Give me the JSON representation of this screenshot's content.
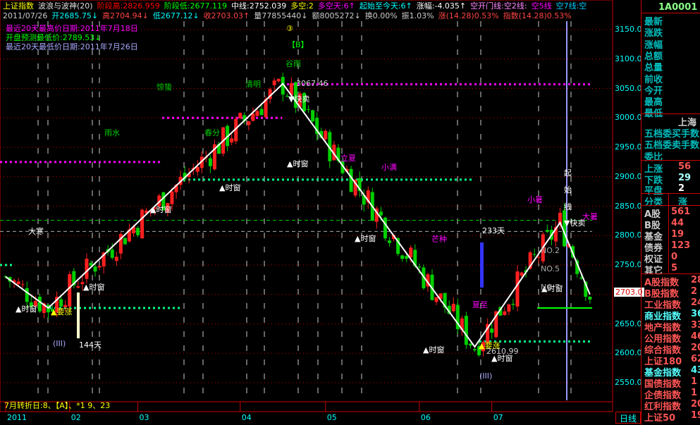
{
  "header": {
    "row1": [
      {
        "t": "上证指数",
        "c": "#ff0"
      },
      {
        "t": "波浪与波神(20)",
        "c": "#ddd"
      },
      {
        "t": "阶段高:2826.959",
        "c": "#f00"
      },
      {
        "t": "阶段低:2677.119",
        "c": "#0f0"
      },
      {
        "t": "中线:2752.039",
        "c": "#fff"
      },
      {
        "t": "多空:2",
        "c": "#ff0"
      },
      {
        "t": "多空天:6↑",
        "c": "#f0f"
      },
      {
        "t": "起始至今天:6↑",
        "c": "#0ff"
      },
      {
        "t": "涨幅:-4.035↑",
        "c": "#fff"
      },
      {
        "t": "空开门线:空2线:",
        "c": "#f8f"
      },
      {
        "t": "空5线",
        "c": "#f0f"
      },
      {
        "t": "空7线:空",
        "c": "#0cf"
      }
    ],
    "row2": [
      {
        "t": "2011/07/26",
        "c": "#ccc"
      },
      {
        "t": "开2685.75↓",
        "c": "#0ff"
      },
      {
        "t": "高2704.94↓",
        "c": "#f44"
      },
      {
        "t": "低2677.12↓",
        "c": "#0ff"
      },
      {
        "t": "收2703.03↑",
        "c": "#f44"
      },
      {
        "t": "量77855440↓",
        "c": "#ccc"
      },
      {
        "t": "额8005272↓",
        "c": "#ccc"
      },
      {
        "t": "换0.00%",
        "c": "#ccc"
      },
      {
        "t": "振1.03%",
        "c": "#ccc"
      },
      {
        "t": "涨(14.28)0.53%",
        "c": "#f44"
      },
      {
        "t": "指数(14.28)0.53%",
        "c": "#f44"
      }
    ],
    "info": [
      {
        "t": "最近20天最高价日期:2011年7月18日",
        "c": "#f0f"
      },
      {
        "t": "开盘预测最低价:2789.53↓",
        "c": "#0f0"
      },
      {
        "t": "最近20天最低价日期:2011年7月26日",
        "c": "#aaf"
      }
    ]
  },
  "code": "1A0001",
  "axis": {
    "prices": [
      "3150.0",
      "3100.0",
      "3050.0",
      "3000.0",
      "2950.0",
      "2900.0",
      "2850.0",
      "2800.0",
      "2750.0",
      "2700.0",
      "2650.0",
      "2600.0",
      "2550.0"
    ],
    "current": "2703.0"
  },
  "months": [
    {
      "t": "2011",
      "d": 0
    },
    {
      "t": "02",
      "d": 15
    },
    {
      "t": "03",
      "d": 31
    },
    {
      "t": "04",
      "d": 55
    },
    {
      "t": "05",
      "d": 75
    },
    {
      "t": "06",
      "d": 97
    },
    {
      "t": "07",
      "d": 114
    }
  ],
  "period": "日线",
  "turning": "7月转折日:8、【A】、*1 9、23",
  "zigzag": [
    [
      0,
      2730
    ],
    [
      10,
      2677
    ],
    [
      65,
      3058
    ],
    [
      110,
      2611
    ],
    [
      130,
      2822
    ],
    [
      137,
      2700
    ]
  ],
  "annotations": {
    "terms": [
      {
        "t": "大寒",
        "c": "#fff"
      },
      {
        "t": "雨水",
        "c": "#0c0"
      },
      {
        "t": "惊蛰",
        "c": "#0c0"
      },
      {
        "t": "春分",
        "c": "#0c0"
      },
      {
        "t": "清明",
        "c": "#0c0"
      },
      {
        "t": "谷雨",
        "c": "#0c0"
      },
      {
        "t": "立夏",
        "c": "#f0f"
      },
      {
        "t": "小满",
        "c": "#f0f"
      },
      {
        "t": "芒种",
        "c": "#f0f"
      },
      {
        "t": "夏至",
        "c": "#f0f"
      },
      {
        "t": "小暑",
        "c": "#f0f"
      },
      {
        "t": "大暑",
        "c": "#f0f"
      }
    ],
    "window": "▲时窗",
    "sell": "▼快卖",
    "rise": "▲要涨",
    "high_val": "3067.46",
    "low_val": "2610.99",
    "days144": "144天",
    "days233": "233天",
    "wave": "(III)",
    "circle3": "③",
    "markB": "【B】",
    "start_line": [
      "起",
      "始",
      "线"
    ],
    "levels": [
      "NO.2",
      "NO.5",
      "NO.7"
    ]
  },
  "panel": {
    "quote_labels": [
      "最新",
      "涨跌",
      "涨幅",
      "总额",
      "总量",
      "前收",
      "今开",
      "最高",
      "最低"
    ],
    "market": "上海",
    "order_labels": [
      "五档委买手数",
      "五档委卖手数",
      "委比"
    ],
    "breadth": [
      {
        "l": "上涨",
        "v": "56"
      },
      {
        "l": "下跌",
        "v": "29"
      },
      {
        "l": "平盘",
        "v": "2"
      }
    ],
    "class_header": [
      "分类",
      "涨"
    ],
    "classes": [
      {
        "l": "A股",
        "v": "561"
      },
      {
        "l": "B股",
        "v": "44"
      },
      {
        "l": "基金",
        "v": "19"
      },
      {
        "l": "债券",
        "v": "123"
      },
      {
        "l": "权证",
        "v": "0"
      },
      {
        "l": "其它",
        "v": "5"
      }
    ],
    "indices": [
      {
        "l": "A股指数",
        "v": "28",
        "c": "#f55"
      },
      {
        "l": "B股指数",
        "v": "2",
        "c": "#f55"
      },
      {
        "l": "工业指数",
        "v": "24",
        "c": "#f55"
      },
      {
        "l": "商业指数",
        "v": "36",
        "c": "#5ff"
      },
      {
        "l": "地产指数",
        "v": "33",
        "c": "#f55"
      },
      {
        "l": "公用指数",
        "v": "46",
        "c": "#f55"
      },
      {
        "l": "综合指数",
        "v": "20",
        "c": "#f55"
      },
      {
        "l": "上证180",
        "v": "62",
        "c": "#f55"
      },
      {
        "l": "基金指数",
        "v": "43",
        "c": "#5ff"
      },
      {
        "l": "国债指数",
        "v": "1",
        "c": "#f55"
      },
      {
        "l": "企债指数",
        "v": "1",
        "c": "#f55"
      },
      {
        "l": "红利指数",
        "v": "20",
        "c": "#f55"
      },
      {
        "l": "上证50",
        "v": "19",
        "c": "#f55"
      }
    ]
  },
  "colors": {
    "up": "#ff2020",
    "down": "#00d000",
    "grid": "#c00000"
  }
}
